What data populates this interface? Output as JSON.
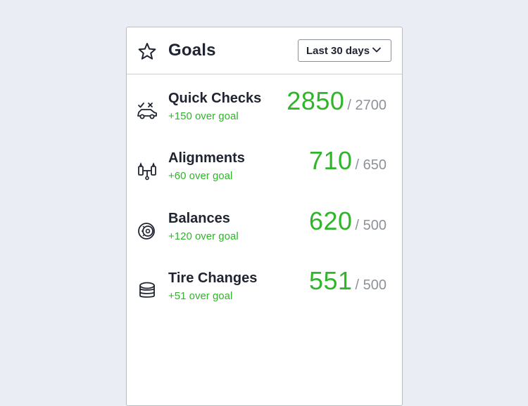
{
  "header": {
    "title": "Goals",
    "title_icon": "star-icon",
    "range_select": {
      "value": "Last 30 days",
      "icon": "chevron-down-icon"
    }
  },
  "goals": [
    {
      "name": "Quick Checks",
      "delta": "+150 over goal",
      "actual": "2850",
      "target": "/ 2700",
      "icon": "car-check-icon"
    },
    {
      "name": "Alignments",
      "delta": "+60 over goal",
      "actual": "710",
      "target": "/ 650",
      "icon": "alignment-icon"
    },
    {
      "name": "Balances",
      "delta": "+120 over goal",
      "actual": "620",
      "target": "/ 500",
      "icon": "wheel-balance-icon"
    },
    {
      "name": "Tire Changes",
      "delta": "+51 over goal",
      "actual": "551",
      "target": "/ 500",
      "icon": "tire-stack-icon"
    }
  ],
  "colors": {
    "positive": "#2fb52a",
    "text": "#1f2430",
    "muted": "#8d929a",
    "background": "#eaedf4"
  }
}
